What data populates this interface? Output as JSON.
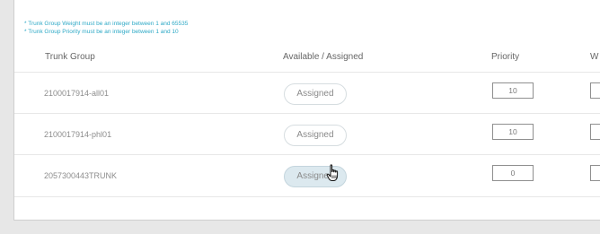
{
  "notes": {
    "weight_rule": "* Trunk Group Weight must be an integer between 1 and 65535",
    "priority_rule": "* Trunk Group Priority must be an integer between 1 and 10"
  },
  "table": {
    "headers": {
      "trunk_group": "Trunk Group",
      "available_assigned": "Available / Assigned",
      "priority": "Priority",
      "weight": "W"
    },
    "rows": [
      {
        "trunk_group": "2100017914-all01",
        "status": "Assigned",
        "priority": "10",
        "weight": ""
      },
      {
        "trunk_group": "2100017914-phl01",
        "status": "Assigned",
        "priority": "10",
        "weight": ""
      },
      {
        "trunk_group": "2057300443TRUNK",
        "status": "Assigned",
        "priority": "0",
        "weight": ""
      }
    ]
  },
  "colors": {
    "note_text": "#2ea9c6",
    "hover_pill": "#dce9ef"
  },
  "icons": {
    "cursor": "hand-pointer-icon"
  }
}
